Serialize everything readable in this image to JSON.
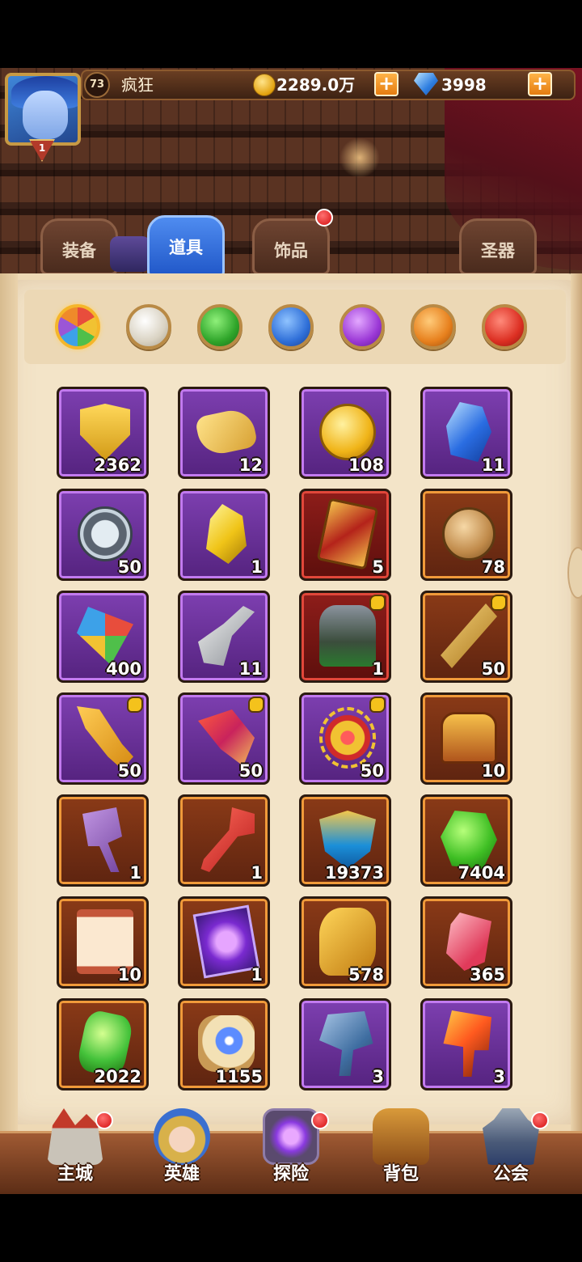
{
  "player": {
    "level": "73",
    "name": "疯狂",
    "rank": "1",
    "gold": "2289.0万",
    "gems": "3998"
  },
  "tabs": [
    {
      "label": "装备",
      "active": false
    },
    {
      "label": "道具",
      "active": true
    },
    {
      "label": "饰品",
      "active": false,
      "notification": true
    },
    {
      "label": "圣器",
      "active": false
    }
  ],
  "filters": [
    {
      "color": "all",
      "selected": true
    },
    {
      "color": "#d9d2c2"
    },
    {
      "color": "#2fa52a"
    },
    {
      "color": "#2f6fd8"
    },
    {
      "color": "#9b38d6"
    },
    {
      "color": "#e7801d"
    },
    {
      "color": "#dc2f22"
    }
  ],
  "items": [
    {
      "icon": "gold-shield-icon",
      "rarity": "purple",
      "count": "2362"
    },
    {
      "icon": "gold-puzzle-icon",
      "rarity": "purple",
      "count": "12"
    },
    {
      "icon": "gold-coin-icon",
      "rarity": "purple",
      "count": "108"
    },
    {
      "icon": "blue-crystal-icon",
      "rarity": "purple",
      "count": "11"
    },
    {
      "icon": "magnifier-icon",
      "rarity": "purple",
      "count": "50"
    },
    {
      "icon": "yellow-crystal-icon",
      "rarity": "purple",
      "count": "1"
    },
    {
      "icon": "red-card-icon",
      "rarity": "red",
      "count": "5"
    },
    {
      "icon": "bronze-coin-icon",
      "rarity": "orange",
      "count": "78"
    },
    {
      "icon": "kite-icon",
      "rarity": "purple",
      "count": "400"
    },
    {
      "icon": "shovel-icon",
      "rarity": "purple",
      "count": "11"
    },
    {
      "icon": "gauntlet-icon",
      "rarity": "red",
      "count": "1",
      "shard": true
    },
    {
      "icon": "golden-sword-icon",
      "rarity": "orange",
      "count": "50",
      "shard": true
    },
    {
      "icon": "golden-blade-icon",
      "rarity": "purple",
      "count": "50",
      "shard": true
    },
    {
      "icon": "phoenix-blade-icon",
      "rarity": "purple",
      "count": "50",
      "shard": true
    },
    {
      "icon": "sun-medallion-icon",
      "rarity": "purple",
      "count": "50",
      "shard": true
    },
    {
      "icon": "treasure-chest-icon",
      "rarity": "orange",
      "count": "10"
    },
    {
      "icon": "purple-hammer-icon",
      "rarity": "orange",
      "count": "1"
    },
    {
      "icon": "red-key-icon",
      "rarity": "orange",
      "count": "1"
    },
    {
      "icon": "crown-emblem-icon",
      "rarity": "orange",
      "count": "19373"
    },
    {
      "icon": "green-gem-icon",
      "rarity": "orange",
      "count": "7404"
    },
    {
      "icon": "red-scroll-icon",
      "rarity": "orange",
      "count": "10"
    },
    {
      "icon": "portal-card-icon",
      "rarity": "orange",
      "count": "1"
    },
    {
      "icon": "golden-rune-icon",
      "rarity": "orange",
      "count": "578"
    },
    {
      "icon": "pink-rune-icon",
      "rarity": "orange",
      "count": "365"
    },
    {
      "icon": "leaf-gem-icon",
      "rarity": "orange",
      "count": "2022"
    },
    {
      "icon": "orb-scroll-icon",
      "rarity": "orange",
      "count": "1155"
    },
    {
      "icon": "stone-hammer-icon",
      "rarity": "purple",
      "count": "3"
    },
    {
      "icon": "lava-hammer-icon",
      "rarity": "purple",
      "count": "3"
    }
  ],
  "nav": [
    {
      "label": "主城",
      "icon": "castle-icon",
      "notification": true
    },
    {
      "label": "英雄",
      "icon": "hero-icon",
      "notification": false
    },
    {
      "label": "探险",
      "icon": "adventure-portal-icon",
      "notification": true
    },
    {
      "label": "背包",
      "icon": "backpack-icon",
      "notification": false
    },
    {
      "label": "公会",
      "icon": "guild-icon",
      "notification": true
    }
  ]
}
